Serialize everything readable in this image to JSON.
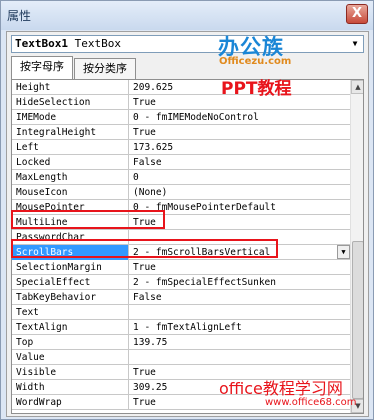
{
  "window": {
    "title": "属性",
    "close_glyph": "X"
  },
  "object_selector": {
    "name": "TextBox1",
    "type": "TextBox",
    "dropdown_icon": "chevron-down-icon"
  },
  "tabs": [
    {
      "label": "按字母序",
      "active": true
    },
    {
      "label": "按分类序",
      "active": false
    }
  ],
  "properties": [
    {
      "name": "Height",
      "value": "209.625"
    },
    {
      "name": "HideSelection",
      "value": "True"
    },
    {
      "name": "IMEMode",
      "value": "0 - fmIMEModeNoControl"
    },
    {
      "name": "IntegralHeight",
      "value": "True"
    },
    {
      "name": "Left",
      "value": "173.625"
    },
    {
      "name": "Locked",
      "value": "False"
    },
    {
      "name": "MaxLength",
      "value": "0"
    },
    {
      "name": "MouseIcon",
      "value": "(None)"
    },
    {
      "name": "MousePointer",
      "value": "0 - fmMousePointerDefault"
    },
    {
      "name": "MultiLine",
      "value": "True",
      "highlighted": true
    },
    {
      "name": "PasswordChar",
      "value": ""
    },
    {
      "name": "ScrollBars",
      "value": "2 - fmScrollBarsVertical",
      "selected": true,
      "highlighted": true
    },
    {
      "name": "SelectionMargin",
      "value": "True"
    },
    {
      "name": "SpecialEffect",
      "value": "2 - fmSpecialEffectSunken"
    },
    {
      "name": "TabKeyBehavior",
      "value": "False"
    },
    {
      "name": "Text",
      "value": ""
    },
    {
      "name": "TextAlign",
      "value": "1 - fmTextAlignLeft"
    },
    {
      "name": "Top",
      "value": "139.75"
    },
    {
      "name": "Value",
      "value": ""
    },
    {
      "name": "Visible",
      "value": "True"
    },
    {
      "name": "Width",
      "value": "309.25"
    },
    {
      "name": "WordWrap",
      "value": "True"
    }
  ],
  "watermarks": {
    "logo_text": "办公族",
    "logo_sub": "Officezu.com",
    "ppt_text": "PPT教程",
    "bottom_title": "office教程学习网",
    "bottom_url": "www.office68.com"
  },
  "colors": {
    "selection": "#3399ff",
    "highlight_border": "#e8141b",
    "watermark_red": "#e8141b",
    "watermark_blue": "#1a86d6"
  }
}
